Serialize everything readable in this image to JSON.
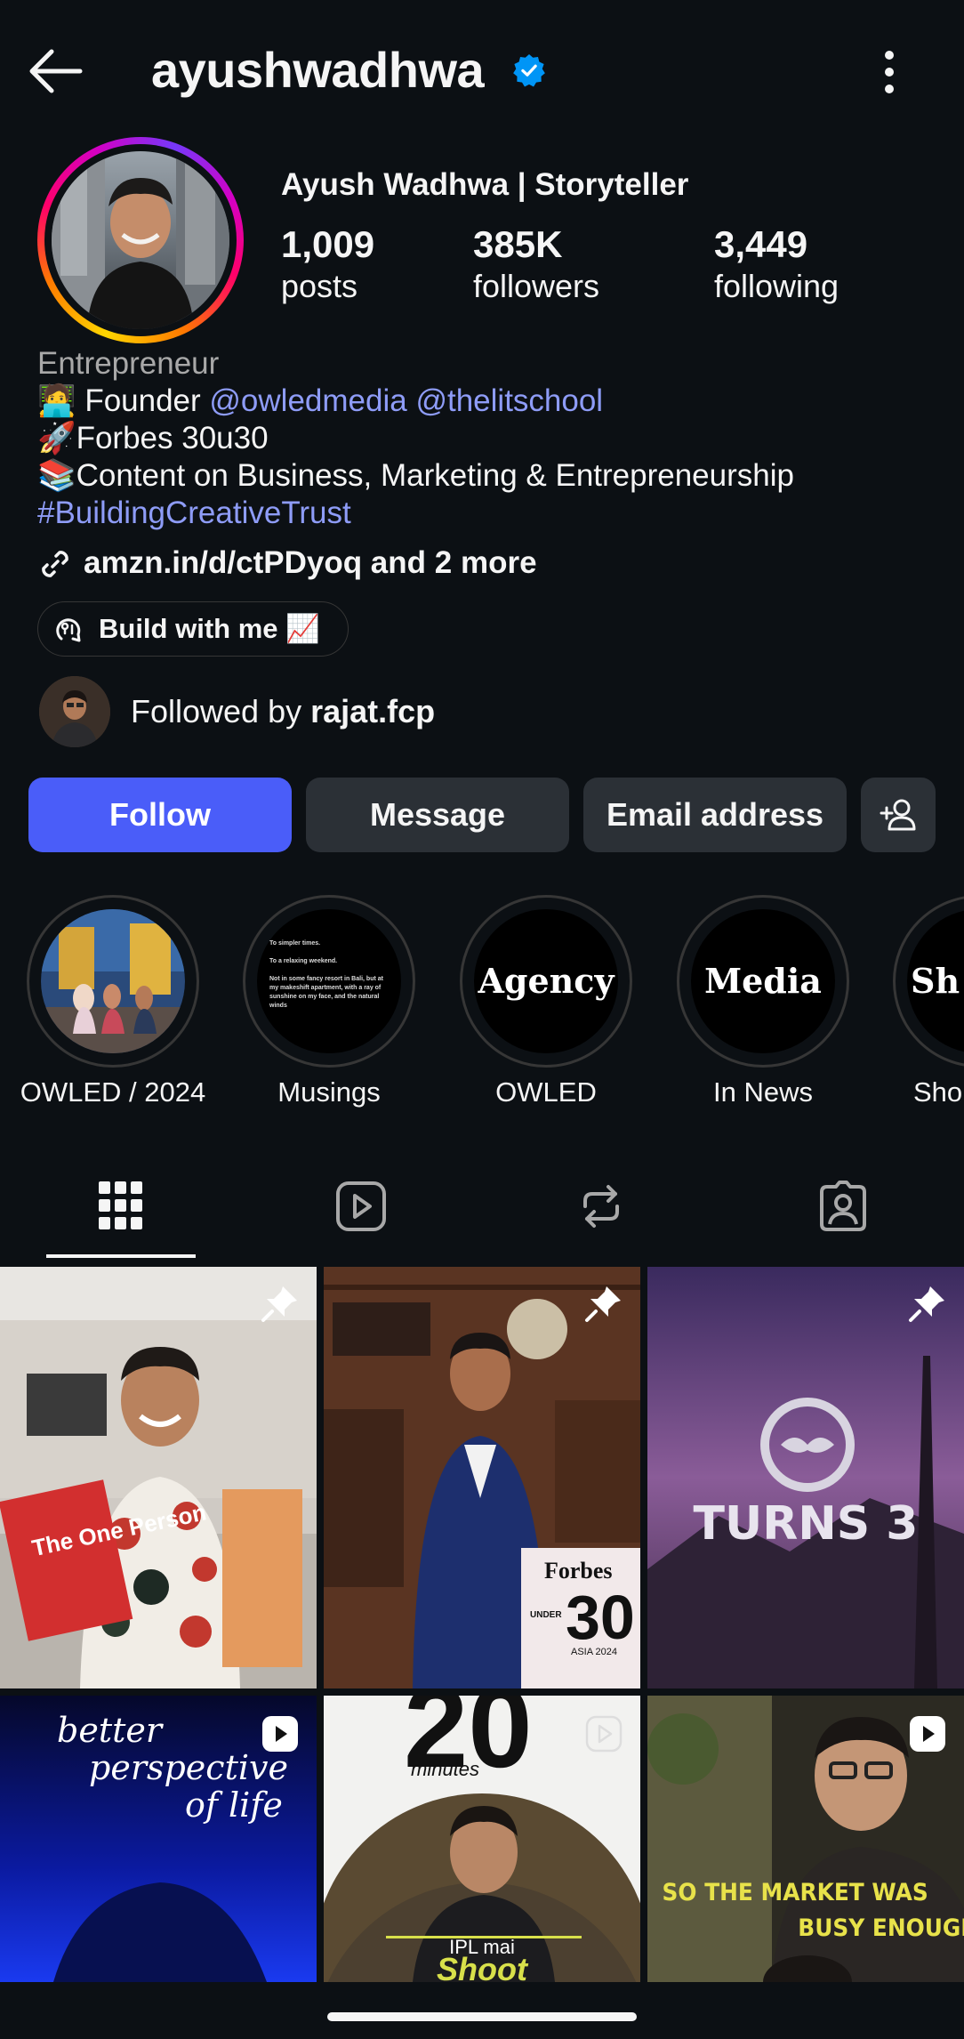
{
  "header": {
    "username": "ayushwadhwa",
    "verified": true,
    "back_icon": "arrow-left-icon",
    "more_icon": "more-vertical-icon"
  },
  "profile": {
    "display_name": "Ayush Wadhwa | Storyteller",
    "stats": [
      {
        "value": "1,009",
        "label": "posts"
      },
      {
        "value": "385K",
        "label": "followers"
      },
      {
        "value": "3,449",
        "label": "following"
      }
    ],
    "category": "Entrepreneur",
    "bio": {
      "line1_emoji": "🧑‍💻",
      "line1_text": " Founder ",
      "mention1": "@owledmedia",
      "mention2": "@thelitschool",
      "line2": "🚀Forbes 30u30",
      "line3": "📚Content on Business, Marketing & Entrepreneurship",
      "hashtag": "#BuildingCreativeTrust"
    },
    "link": "amzn.in/d/ctPDyoq and 2 more",
    "threads_chip": "Build with me 📈",
    "followed_by_prefix": "Followed by ",
    "followed_by_user": "rajat.fcp"
  },
  "actions": {
    "follow": "Follow",
    "message": "Message",
    "email": "Email address",
    "add_user_icon": "add-user-icon"
  },
  "highlights": [
    {
      "label": "OWLED / 2024",
      "cover": "photo"
    },
    {
      "label": "Musings",
      "cover": "text"
    },
    {
      "label": "OWLED",
      "cover_text": "Agency"
    },
    {
      "label": "In News",
      "cover_text": "Media"
    },
    {
      "label": "Sho",
      "cover_text": "Sh"
    }
  ],
  "musings_cover_lines": [
    "To simpler times.",
    "To a relaxing weekend.",
    "Not in some fancy resort in Bali, but at",
    "my makeshift apartment, with a ray of",
    "sunshine on my face, and the natural",
    "winds"
  ],
  "tabs": [
    "grid-icon",
    "reels-icon",
    "reposts-icon",
    "tagged-icon"
  ],
  "posts": [
    {
      "pinned": true,
      "overlay": "The One Person"
    },
    {
      "pinned": true,
      "overlay_brand": "Forbes",
      "overlay_big": "30",
      "overlay_under": "UNDER",
      "overlay_sub": "ASIA 2024"
    },
    {
      "pinned": true,
      "overlay": "TURNS 3"
    },
    {
      "reel": true,
      "overlay_lines": [
        "better",
        "perspective",
        "of life"
      ]
    },
    {
      "reel": true,
      "overlay_big": "20",
      "overlay_small": "minutes",
      "overlay_bottom1": "IPL mai",
      "overlay_bottom2": "Shoot"
    },
    {
      "reel": true,
      "overlay_line1": "SO THE MARKET WAS",
      "overlay_line2": "BUSY ENOUGH"
    }
  ],
  "colors": {
    "background": "#0c1014",
    "follow_button": "#4a5df9",
    "secondary_button": "#2b3036",
    "link_blue": "#8e9cf7",
    "verified_blue": "#0095f6"
  }
}
